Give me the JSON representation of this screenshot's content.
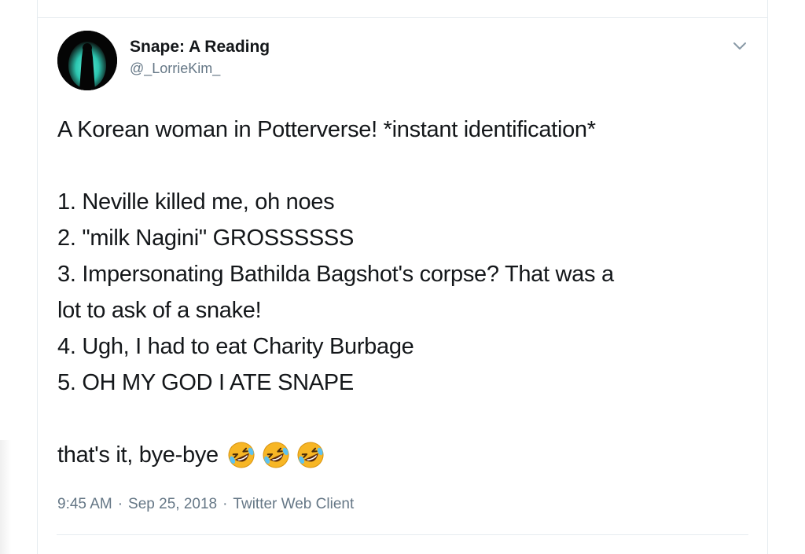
{
  "tweet": {
    "author": {
      "display_name": "Snape: A Reading",
      "handle": "@_LorrieKim_"
    },
    "text": {
      "intro": "A Korean woman in Potterverse! *instant identification*",
      "items": [
        "1. Neville killed me, oh noes",
        "2. \"milk Nagini\" GROSSSSSS",
        "3. Impersonating Bathilda Bagshot's corpse? That was a",
        "lot to ask of a snake!",
        "4. Ugh, I had to eat Charity Burbage",
        "5. OH MY GOD I ATE SNAPE"
      ],
      "outro": "that's it, bye-bye",
      "emoji": [
        "rolling-on-floor-laughing",
        "rolling-on-floor-laughing",
        "rolling-on-floor-laughing"
      ]
    },
    "meta": {
      "time": "9:45 AM",
      "separator": "·",
      "date": "Sep 25, 2018",
      "source": "Twitter Web Client"
    },
    "menu_icon": "chevron-down-icon"
  },
  "colors": {
    "text_primary": "#14171a",
    "text_secondary": "#657786",
    "border": "#e6ecf0",
    "avatar_glow": "#3fe0c8",
    "emoji_face": "#f7b625"
  }
}
